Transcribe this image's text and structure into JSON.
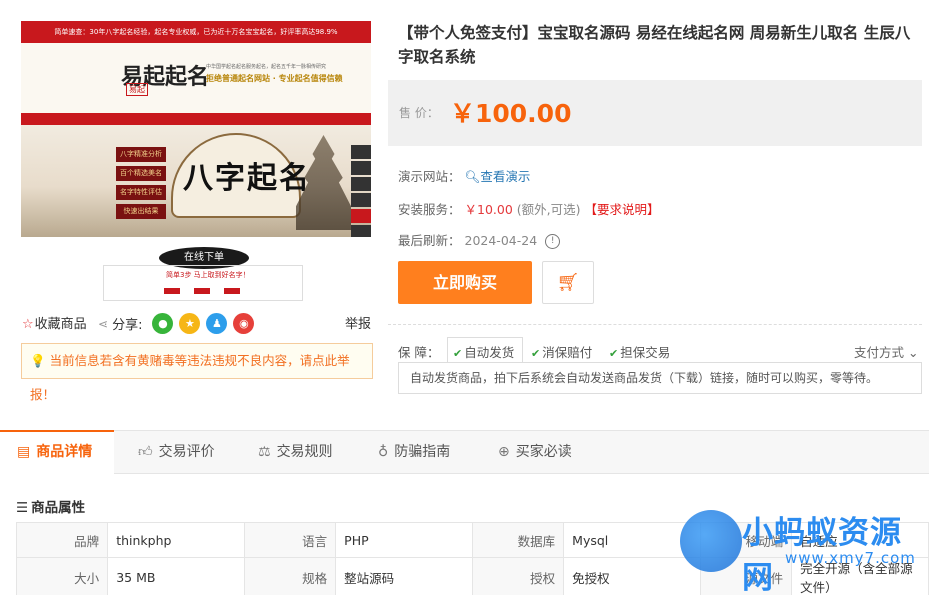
{
  "image": {
    "top_bar_text": "简单速查：30年八字起名经验，起名专业权威，已为近十万名宝宝起名，好评率高达98.9%",
    "logo_text": "易起起名",
    "logo_tag": "易起",
    "slogan_small": "中华国学起名起名服务起名，起名五千年一脉相传研究",
    "slogan_big": "拒绝普通起名网站 · 专业起名值得信赖",
    "banner_pills": [
      "八字精准分析",
      "百个精选美名",
      "名字特性评估",
      "快速出结果"
    ],
    "banner_title": "八字起名",
    "lower_ink_text": "在线下单",
    "lower_card_text": "简单3步 马上取到好名字！"
  },
  "left": {
    "favorite_label": "收藏商品",
    "share_label": "分享:",
    "report_label": "举报",
    "warning_text": "当前信息若含有黄赌毒等违法违规不良内容，请点此举报！"
  },
  "product": {
    "title": "【带个人免签支付】宝宝取名源码 易经在线起名网 周易新生儿取名 生辰八字取名系统",
    "price_label": "售  价：",
    "price": "￥100.00",
    "demo_label": "演示网站：",
    "demo_link": "查看演示",
    "install_label": "安装服务：",
    "install_price": "￥10.00",
    "install_note": "(额外,可选)",
    "install_req": "【要求说明】",
    "refresh_label": "最后刷新：",
    "refresh_date": "2024-04-24",
    "buy_label": "立即购买",
    "guarantee_label": "保  障：",
    "guarantees": [
      "自动发货",
      "消保赔付",
      "担保交易"
    ],
    "pay_label": "支付方式",
    "delivery_desc": "自动发货商品，拍下后系统会自动发送商品发货（下载）链接，随时可以购买，零等待。"
  },
  "tabs": [
    "商品详情",
    "交易评价",
    "交易规则",
    "防骗指南",
    "买家必读"
  ],
  "attributes": {
    "heading": "商品属性",
    "rows": [
      [
        [
          "品牌",
          "thinkphp"
        ],
        [
          "语言",
          "PHP"
        ],
        [
          "数据库",
          "Mysql"
        ],
        [
          "移动端",
          "自适应"
        ]
      ],
      [
        [
          "大小",
          "35 MB"
        ],
        [
          "规格",
          "整站源码"
        ],
        [
          "授权",
          "免授权"
        ],
        [
          "源文件",
          "完全开源（含全部源文件）"
        ]
      ]
    ]
  },
  "watermark": {
    "title": "小蚂蚁资源网",
    "url": "www.xmy7.com"
  },
  "colors": {
    "accent": "#f7630c",
    "brand_red": "#c8181d",
    "link_blue": "#2878b4"
  }
}
